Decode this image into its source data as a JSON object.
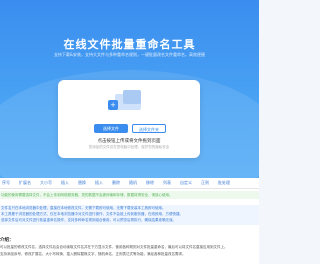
{
  "hero": {
    "title": "在线文件批量重命名工具",
    "subtitle": "支持下载&安装，支持大文件与多种重命名规则，一键批量改名文件重命名，高效便捷"
  },
  "upload": {
    "select_files_button": "选择文件",
    "select_folder_button": "选择文件夹",
    "drop_hint": "点击按钮上传或将文件拖到页面",
    "drop_subhint": "您添加的文件仅在您电脑中处理，保护您的隐私安全"
  },
  "tabs": [
    "序号",
    "扩展名",
    "大小写",
    "插入",
    "替换",
    "插入",
    "删除",
    "随机",
    "移除",
    "列表",
    "自定义",
    "正则",
    "批处理"
  ],
  "tips": {
    "green": "功能的使用需要选择文件，不会上传到网络服务器，您的数据不会被传输和存储，数据将得安全，请放心使用。",
    "blue_lines": [
      "文件名只在本地浏览器中处理，直接在本地修改文件，无需下载即可使用，无需下载安装本工具即可使用。",
      "本工具基于浏览器的处理方式，仅在本地浏览器中对文件进行操作，文件不会被上传到服务器，在线即用，方便快捷。",
      "选择文件后可对文件进行批量重命名操作，支持多种命名规则组合使用，可以预览后再执行，确保结果准确无误。"
    ]
  },
  "section": {
    "title": "介绍：",
    "text": "可以批量的修改文件名，选择文件后会自动读取文件名并在下方显示文件，使用各种规则对文件批量重命名，最后可以将文件名直接应用到文件上。",
    "text2": "支持添加序号、修改扩展名、大小写转换、插入删除替换文字、随机命名、正则表达式等功能，满足各种批量改名需求。"
  }
}
